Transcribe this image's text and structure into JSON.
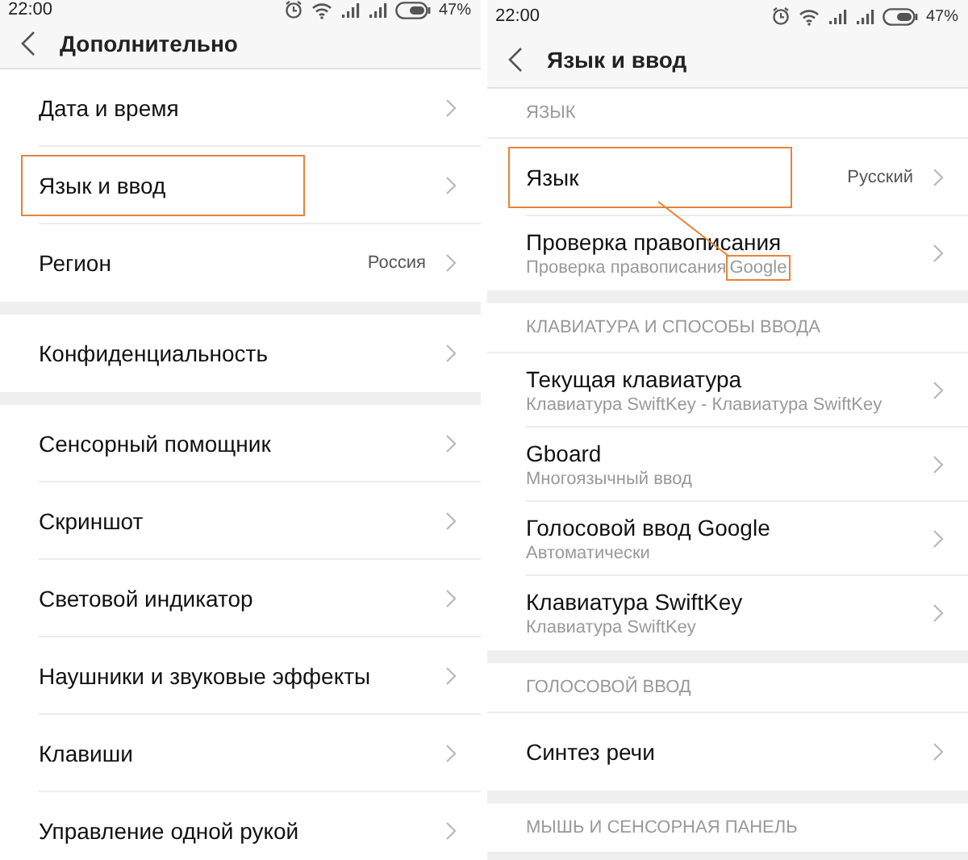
{
  "screens": [
    {
      "status_bar": {
        "time": "22:00",
        "battery": "47%"
      },
      "title": "Дополнительно",
      "groups": [
        {
          "items": [
            {
              "label": "Дата и время",
              "highlighted": false
            },
            {
              "label": "Язык и ввод",
              "highlighted": true
            },
            {
              "label": "Регион",
              "value": "Россия",
              "highlighted": false
            }
          ]
        },
        {
          "items": [
            {
              "label": "Конфиденциальность",
              "highlighted": false
            }
          ]
        },
        {
          "items": [
            {
              "label": "Сенсорный помощник",
              "highlighted": false
            },
            {
              "label": "Скриншот",
              "highlighted": false
            },
            {
              "label": "Световой индикатор",
              "highlighted": false
            },
            {
              "label": "Наушники и звуковые эффекты",
              "highlighted": false
            },
            {
              "label": "Клавиши",
              "highlighted": false
            },
            {
              "label": "Управление одной рукой",
              "highlighted": false
            }
          ]
        }
      ]
    },
    {
      "status_bar": {
        "time": "22:00",
        "battery": "47%"
      },
      "title": "Язык и ввод",
      "callout_line": true,
      "groups": [
        {
          "header": "ЯЗЫК",
          "items": [
            {
              "label": "Язык",
              "value": "Русский",
              "highlighted": true
            },
            {
              "label": "Проверка правописания",
              "subtitle": "Проверка правописания",
              "subtitle_mark": "Google",
              "highlighted": false
            }
          ]
        },
        {
          "header": "КЛАВИАТУРА И СПОСОБЫ ВВОДА",
          "items": [
            {
              "label": "Текущая клавиатура",
              "subtitle": "Клавиатура SwiftKey - Клавиатура SwiftKey",
              "highlighted": false
            },
            {
              "label": "Gboard",
              "subtitle": "Многоязычный ввод",
              "highlighted": false
            },
            {
              "label": "Голосовой ввод Google",
              "subtitle": "Автоматически",
              "highlighted": false
            },
            {
              "label": "Клавиатура SwiftKey",
              "subtitle": "Клавиатура SwiftKey",
              "highlighted": false
            }
          ]
        },
        {
          "header": "ГОЛОСОВОЙ ВВОД",
          "items": [
            {
              "label": "Синтез речи",
              "highlighted": false
            }
          ]
        },
        {
          "header": "МЫШЬ И СЕНСОРНАЯ ПАНЕЛЬ"
        }
      ]
    }
  ]
}
